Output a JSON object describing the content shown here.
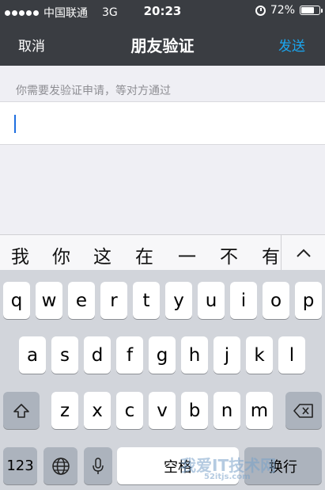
{
  "status": {
    "carrier": "中国联通",
    "network": "3G",
    "time": "20:23",
    "battery": "72%",
    "battery_level": 0.72
  },
  "nav": {
    "cancel": "取消",
    "title": "朋友验证",
    "send": "发送"
  },
  "form": {
    "hint": "你需要发验证申请，等对方通过",
    "value": ""
  },
  "candidates": [
    "我",
    "你",
    "这",
    "在",
    "一",
    "不",
    "有"
  ],
  "keyboard": {
    "row1": [
      "q",
      "w",
      "e",
      "r",
      "t",
      "y",
      "u",
      "i",
      "o",
      "p"
    ],
    "row2": [
      "a",
      "s",
      "d",
      "f",
      "g",
      "h",
      "j",
      "k",
      "l"
    ],
    "row3": [
      "z",
      "x",
      "c",
      "v",
      "b",
      "n",
      "m"
    ],
    "numbers": "123",
    "space": "空格",
    "return": "换行"
  },
  "watermark": {
    "text": "我爱IT技术网",
    "sub": "52itjs.com"
  },
  "colors": {
    "topbar": "#3a3d42",
    "accent": "#1aa6f0",
    "keyboard": "#d2d5db"
  }
}
